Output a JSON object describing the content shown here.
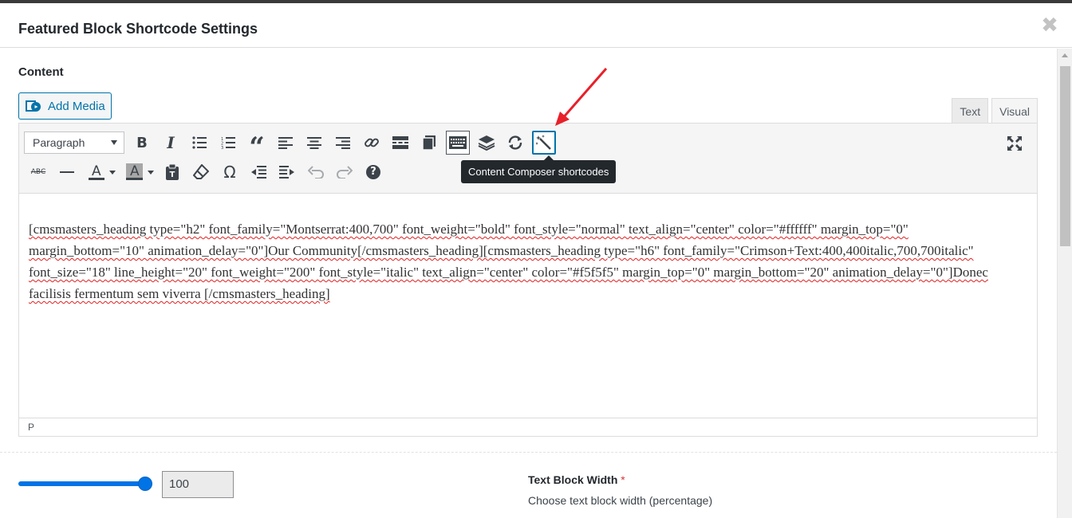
{
  "modal": {
    "title": "Featured Block Shortcode Settings",
    "close_icon": "close-icon"
  },
  "content": {
    "label": "Content",
    "add_media_label": "Add Media"
  },
  "tabs": [
    {
      "label": "Text",
      "active": false
    },
    {
      "label": "Visual",
      "active": true
    }
  ],
  "toolbar": {
    "format_select_value": "Paragraph",
    "row1_icons": [
      "bold-icon",
      "italic-icon",
      "bulleted-list-icon",
      "numbered-list-icon",
      "blockquote-icon",
      "align-left-icon",
      "align-center-icon",
      "align-right-icon",
      "insert-link-icon",
      "read-more-icon",
      "toolbar-toggle-icon",
      "keyboard-icon",
      "layers-icon",
      "refresh-icon",
      "magic-wand-icon",
      "fullscreen-icon"
    ],
    "row2_icons": [
      "strikethrough-icon",
      "horizontal-line-icon",
      "text-color-icon",
      "background-color-icon",
      "paste-as-text-icon",
      "clear-formatting-icon",
      "special-character-icon",
      "outdent-icon",
      "indent-icon",
      "undo-icon",
      "redo-icon",
      "help-icon"
    ],
    "tooltip": "Content Composer shortcodes",
    "strikethrough_text": "ABC",
    "omega": "Ω",
    "help": "?"
  },
  "editor": {
    "content": "[cmsmasters_heading type=\"h2\" font_family=\"Montserrat:400,700\" font_weight=\"bold\" font_style=\"normal\" text_align=\"center\" color=\"#ffffff\" margin_top=\"0\" margin_bottom=\"10\" animation_delay=\"0\"]Our Community[/cmsmasters_heading][cmsmasters_heading type=\"h6\" font_family=\"Crimson+Text:400,400italic,700,700italic\" font_size=\"18\" line_height=\"20\" font_weight=\"200\" font_style=\"italic\" text_align=\"center\" color=\"#f5f5f5\" margin_top=\"0\" margin_bottom=\"20\" animation_delay=\"0\"]Donec facilisis fermentum sem viverra [/cmsmasters_heading]",
    "status_path": "P"
  },
  "text_block_width": {
    "value": "100",
    "slider_fraction": 1.0,
    "label": "Text Block Width",
    "required_mark": "*",
    "description": "Choose text block width (percentage)"
  },
  "colors": {
    "accent": "#0073aa",
    "slider": "#0073e6",
    "annotation_arrow": "#e8202a"
  }
}
